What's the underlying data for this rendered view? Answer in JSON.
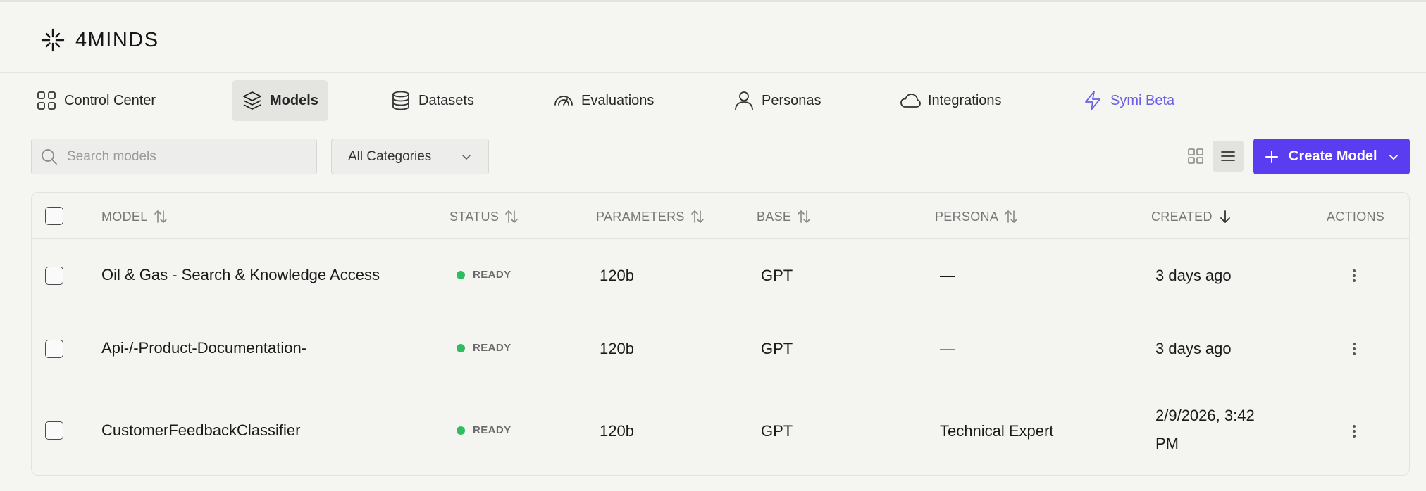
{
  "brand": {
    "name": "4MINDS"
  },
  "nav": [
    {
      "label": "Control Center",
      "icon": "grid-icon"
    },
    {
      "label": "Models",
      "icon": "layers-icon",
      "active": true
    },
    {
      "label": "Datasets",
      "icon": "database-icon"
    },
    {
      "label": "Evaluations",
      "icon": "gauge-icon"
    },
    {
      "label": "Personas",
      "icon": "user-icon"
    },
    {
      "label": "Integrations",
      "icon": "cloud-icon"
    },
    {
      "label": "Symi Beta",
      "icon": "lightning-icon"
    }
  ],
  "toolbar": {
    "search_placeholder": "Search models",
    "category_value": "All Categories",
    "create_label": "Create Model"
  },
  "table": {
    "headers": {
      "model": "MODEL",
      "status": "STATUS",
      "parameters": "PARAMETERS",
      "base": "BASE",
      "persona": "PERSONA",
      "created": "CREATED",
      "actions": "ACTIONS"
    },
    "rows": [
      {
        "model": "Oil & Gas - Search & Knowledge Access",
        "status": "READY",
        "parameters": "120b",
        "base": "GPT",
        "persona": "—",
        "created": "3 days ago"
      },
      {
        "model": "Api-/-Product-Documentation-",
        "status": "READY",
        "parameters": "120b",
        "base": "GPT",
        "persona": "—",
        "created": "3 days ago"
      },
      {
        "model": "CustomerFeedbackClassifier",
        "status": "READY",
        "parameters": "120b",
        "base": "GPT",
        "persona": "Technical Expert",
        "created": "2/9/2026, 3:42 PM"
      }
    ]
  },
  "colors": {
    "accent": "#5a3df0",
    "beta": "#6b5fe6",
    "ready": "#2fbd5f",
    "background": "#f5f5f2"
  }
}
